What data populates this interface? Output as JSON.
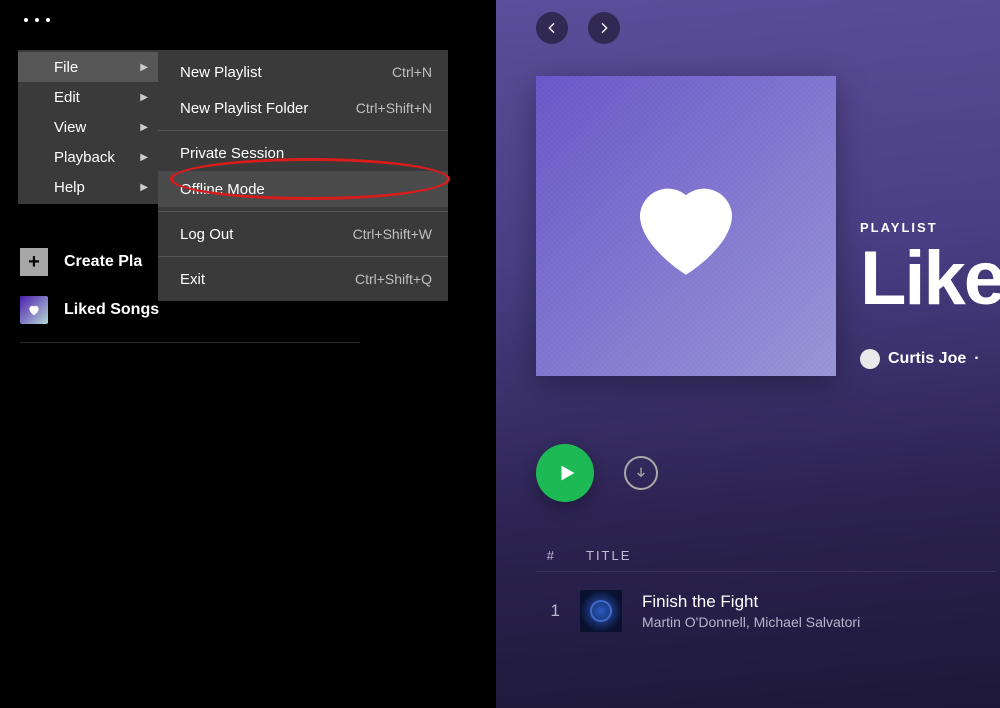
{
  "menubar": {
    "items": [
      {
        "label": "File",
        "active": true
      },
      {
        "label": "Edit"
      },
      {
        "label": "View"
      },
      {
        "label": "Playback"
      },
      {
        "label": "Help"
      }
    ]
  },
  "file_submenu": {
    "groups": [
      [
        {
          "label": "New Playlist",
          "shortcut": "Ctrl+N"
        },
        {
          "label": "New Playlist Folder",
          "shortcut": "Ctrl+Shift+N"
        }
      ],
      [
        {
          "label": "Private Session",
          "shortcut": ""
        },
        {
          "label": "Offline Mode",
          "shortcut": "",
          "highlight": true
        }
      ],
      [
        {
          "label": "Log Out",
          "shortcut": "Ctrl+Shift+W"
        }
      ],
      [
        {
          "label": "Exit",
          "shortcut": "Ctrl+Shift+Q"
        }
      ]
    ]
  },
  "sidebar": {
    "create": "Create Pla",
    "liked": "Liked Songs"
  },
  "playlist": {
    "label": "PLAYLIST",
    "title": "Like",
    "owner": "Curtis Joe",
    "owner_sep": " ·"
  },
  "table": {
    "col_num": "#",
    "col_title": "TITLE"
  },
  "tracks": [
    {
      "num": "1",
      "title": "Finish the Fight",
      "artist": "Martin O'Donnell, Michael Salvatori"
    }
  ],
  "icons": {
    "plus": "+",
    "chev_left": "‹",
    "chev_right": "›"
  },
  "colors": {
    "play_green": "#1db954",
    "highlight_red": "#d81c1c"
  }
}
